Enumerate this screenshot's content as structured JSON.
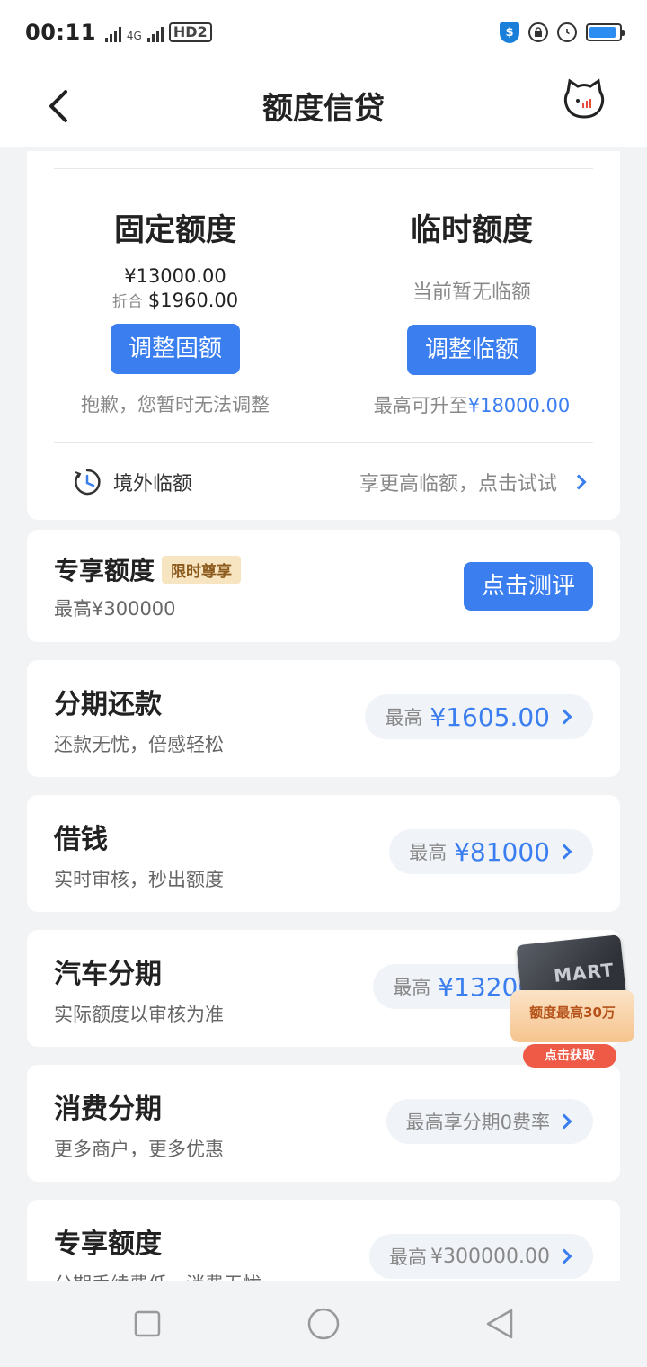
{
  "status_bar": {
    "time": "00:11",
    "network_label": "4G",
    "hd_label": "HD2",
    "shield_glyph": "$",
    "battery_level": 0.9
  },
  "nav": {
    "title": "额度信贷",
    "back_icon": "chevron-left-icon",
    "mascot_icon": "cat-mascot-icon"
  },
  "fixed_quota": {
    "title": "固定额度",
    "amount": "¥13000.00",
    "converted_label": "折合",
    "converted_value": "$1960.00",
    "button": "调整固额",
    "hint": "抱歉，您暂时无法调整"
  },
  "temp_quota": {
    "title": "临时额度",
    "status": "当前暂无临额",
    "button": "调整临额",
    "hint_prefix": "最高可升至",
    "hint_value": "¥18000.00"
  },
  "overseas": {
    "label": "境外临额",
    "tip": "享更高临额，点击试试"
  },
  "exclusive": {
    "title": "专享额度",
    "tag": "限时尊享",
    "subtitle": "最高¥300000",
    "button": "点击测评"
  },
  "items": [
    {
      "title": "分期还款",
      "subtitle": "还款无忧，倍感轻松",
      "pill_label": "最高",
      "pill_value": "¥1605.00"
    },
    {
      "title": "借钱",
      "subtitle": "实时审核，秒出额度",
      "pill_label": "最高",
      "pill_value": "¥81000"
    },
    {
      "title": "汽车分期",
      "subtitle": "实际额度以审核为准",
      "pill_label": "最高",
      "pill_value": "¥132000"
    },
    {
      "title": "消费分期",
      "subtitle": "更多商户，更多优惠",
      "pill_label": "最高享分期0费率",
      "pill_value": ""
    },
    {
      "title": "专享额度",
      "subtitle": "分期手续费低，消费无忧",
      "pill_label": "最高",
      "pill_value": "¥300000.00"
    }
  ],
  "float_ad": {
    "card_text": "MART",
    "body_text": "额度最高30万",
    "button": "点击获取"
  },
  "colors": {
    "accent": "#3a7ef0",
    "background": "#f2f3f5",
    "tag_bg": "#f7e4c0",
    "tag_text": "#8b5a1c"
  }
}
